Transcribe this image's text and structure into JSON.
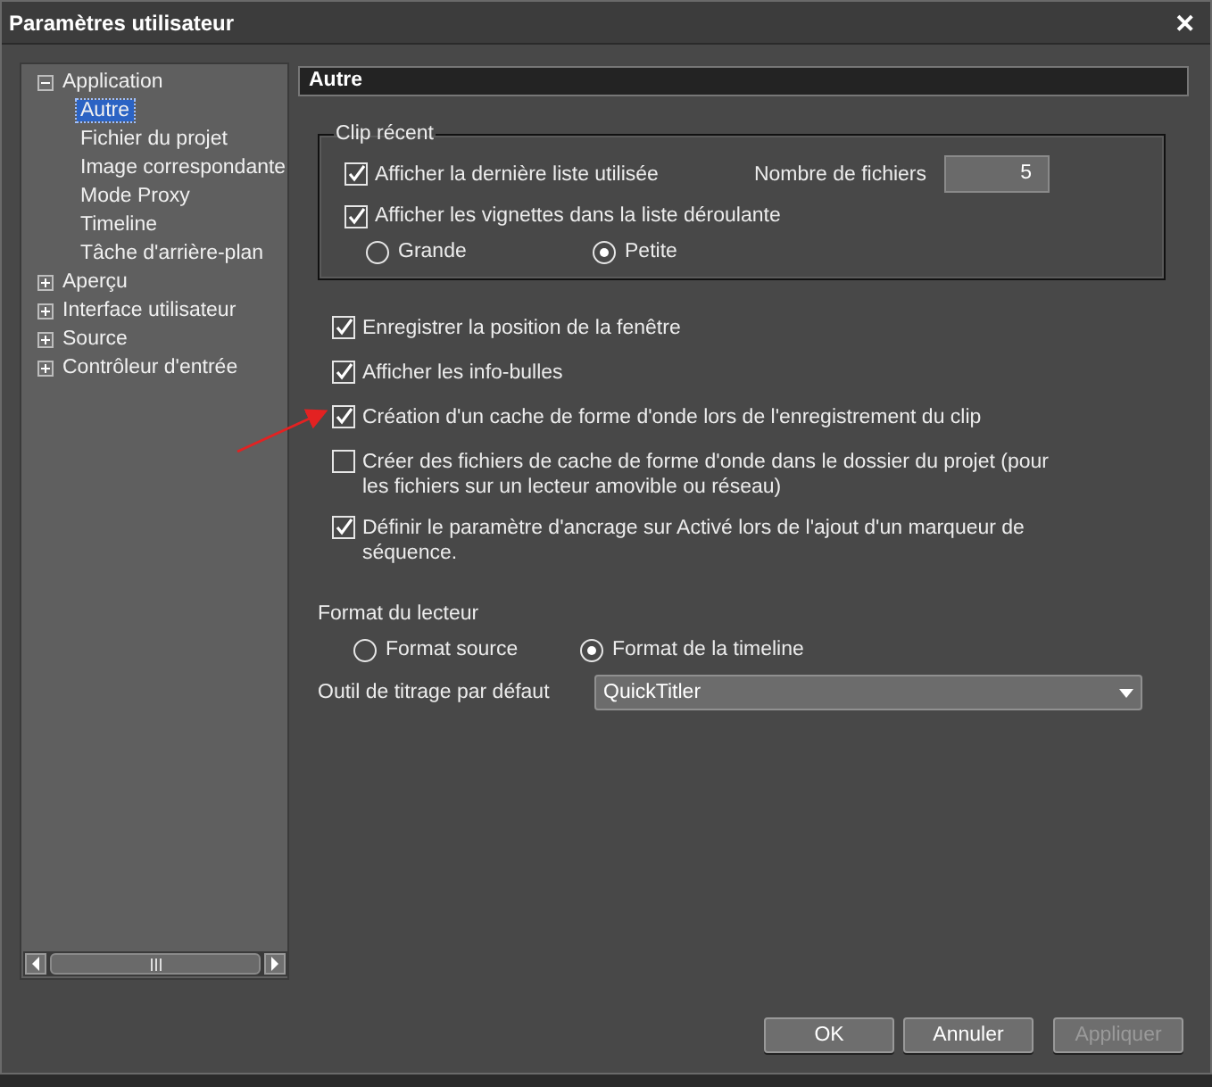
{
  "window": {
    "title": "Paramètres utilisateur",
    "close": "✕"
  },
  "tree": [
    {
      "label": "Application",
      "expanded": true,
      "selected": false,
      "children": [
        {
          "label": "Autre",
          "selected": true
        },
        {
          "label": "Fichier du projet",
          "selected": false
        },
        {
          "label": "Image correspondante",
          "selected": false
        },
        {
          "label": "Mode Proxy",
          "selected": false
        },
        {
          "label": "Timeline",
          "selected": false
        },
        {
          "label": "Tâche d'arrière-plan",
          "selected": false
        }
      ]
    },
    {
      "label": "Aperçu",
      "expanded": false,
      "selected": false
    },
    {
      "label": "Interface utilisateur",
      "expanded": false,
      "selected": false
    },
    {
      "label": "Source",
      "expanded": false,
      "selected": false
    },
    {
      "label": "Contrôleur d'entrée",
      "expanded": false,
      "selected": false
    }
  ],
  "section_title": "Autre",
  "recent_clip": {
    "title": "Clip récent",
    "options": [
      {
        "label": "Afficher la dernière liste utilisée",
        "checked": true
      },
      {
        "label": "Afficher les vignettes dans la liste déroulante",
        "checked": true
      }
    ],
    "file_count": {
      "label": "Nombre de fichiers",
      "value": "5"
    },
    "thumb_size": [
      {
        "label": "Grande",
        "selected": false
      },
      {
        "label": "Petite",
        "selected": true
      }
    ]
  },
  "options": [
    {
      "label": "Enregistrer la position de la fenêtre",
      "checked": true,
      "annotated": false
    },
    {
      "label": "Afficher les info-bulles",
      "checked": true,
      "annotated": false
    },
    {
      "label": "Création d'un cache de forme d'onde lors de l'enregistrement du clip",
      "checked": true,
      "annotated": true
    },
    {
      "label": "Créer des fichiers de cache de forme d'onde dans le dossier du projet (pour les fichiers sur un lecteur amovible ou réseau)",
      "checked": false,
      "annotated": false
    },
    {
      "label": "Définir le paramètre d'ancrage sur Activé lors de l'ajout d'un marqueur de séquence.",
      "checked": true,
      "annotated": false
    }
  ],
  "player_format": {
    "label": "Format du lecteur",
    "choices": [
      {
        "label": "Format source",
        "selected": false
      },
      {
        "label": "Format de la timeline",
        "selected": true
      }
    ]
  },
  "title_tool": {
    "label": "Outil de titrage par défaut",
    "value": "QuickTitler"
  },
  "buttons": [
    {
      "label": "OK",
      "disabled": false
    },
    {
      "label": "Annuler",
      "disabled": false
    },
    {
      "label": "Appliquer",
      "disabled": true
    }
  ]
}
